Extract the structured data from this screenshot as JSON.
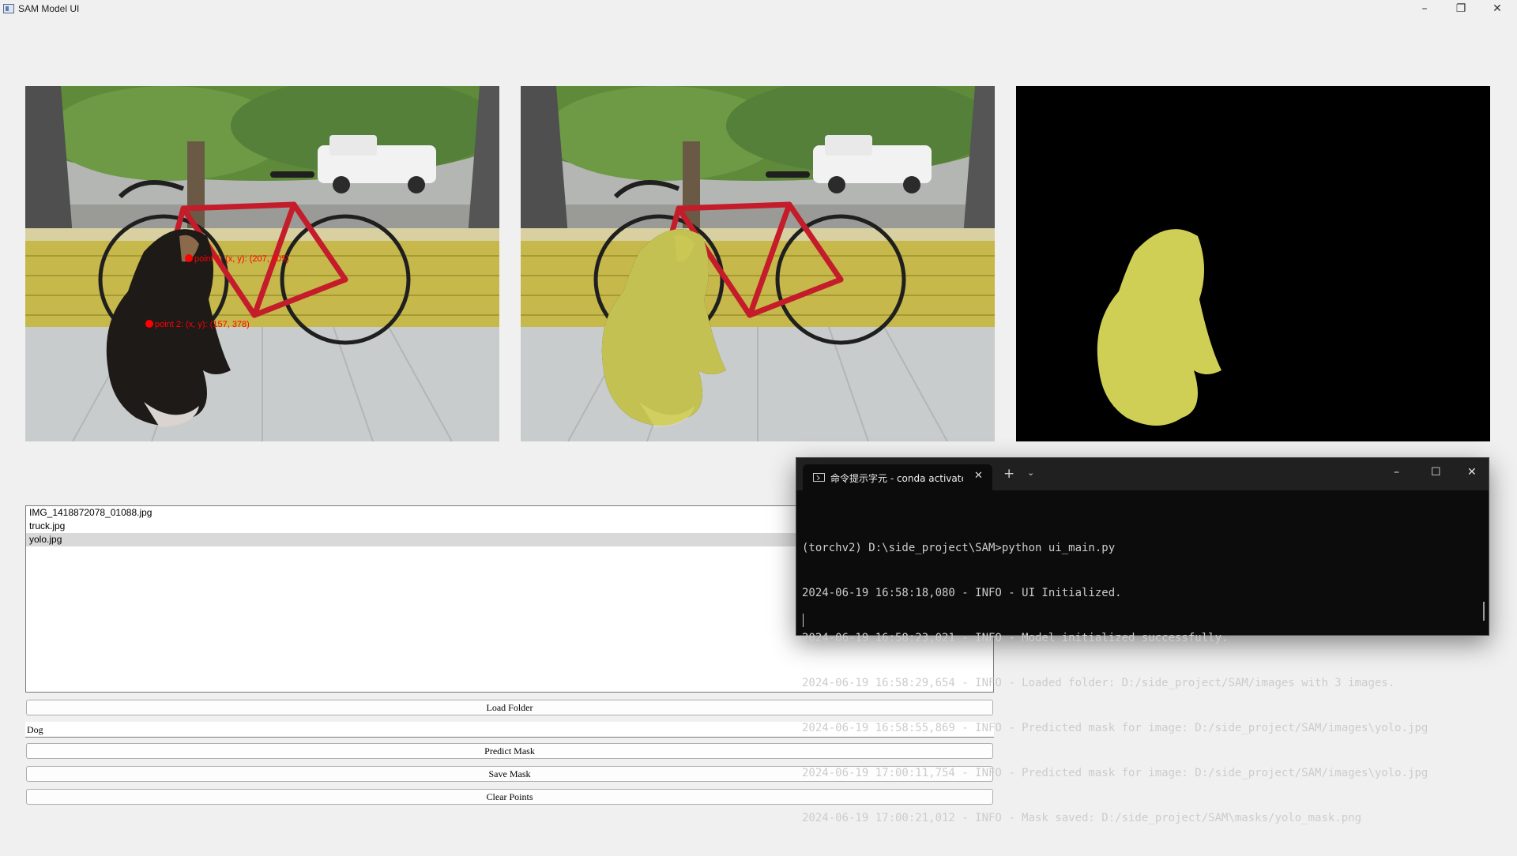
{
  "window": {
    "title": "SAM Model UI",
    "controls": {
      "minimize": "–",
      "maximize": "❐",
      "close": "✕"
    }
  },
  "panels": {
    "left": {
      "point_labels": [
        "point 1: (x, y): (207, 205)",
        "point 2: (x, y): (157, 378)"
      ],
      "point_color": "#ff0000"
    },
    "mask_color": "#cfcf56"
  },
  "file_list": {
    "items": [
      "IMG_1418872078_01088.jpg",
      "truck.jpg",
      "yolo.jpg"
    ],
    "selected_index": 2
  },
  "controls": {
    "load_folder": "Load Folder",
    "prompt_value": "Dog",
    "predict_mask": "Predict Mask",
    "save_mask": "Save Mask",
    "clear_points": "Clear Points"
  },
  "terminal": {
    "tab_title": "命令提示字元 - conda activate",
    "new_tab": "+",
    "dropdown": "⌄",
    "controls": {
      "minimize": "–",
      "maximize": "☐",
      "close": "✕"
    },
    "lines": [
      "(torchv2) D:\\side_project\\SAM>python ui_main.py",
      "2024-06-19 16:58:18,080 - INFO - UI Initialized.",
      "2024-06-19 16:58:23,021 - INFO - Model initialized successfully.",
      "2024-06-19 16:58:29,654 - INFO - Loaded folder: D:/side_project/SAM/images with 3 images.",
      "2024-06-19 16:58:55,869 - INFO - Predicted mask for image: D:/side_project/SAM/images\\yolo.jpg",
      "2024-06-19 17:00:11,754 - INFO - Predicted mask for image: D:/side_project/SAM/images\\yolo.jpg",
      "2024-06-19 17:00:21,012 - INFO - Mask saved: D:/side_project/SAM\\masks/yolo_mask.png"
    ]
  }
}
